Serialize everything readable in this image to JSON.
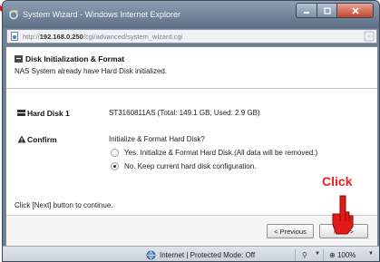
{
  "window": {
    "title": "System Wizard - Windows Internet Explorer"
  },
  "address": {
    "url_prefix": "http://",
    "url_host": "192.168.0.250",
    "url_path": "/cgi/advanced/system_wizard.cgi"
  },
  "wizard": {
    "title": "Disk Initialization & Format",
    "subtitle": "NAS System already have Hard Disk initialized.",
    "hard_disk_label": "Hard Disk 1",
    "hard_disk_value": "ST3160811AS (Total: 149.1 GB, Used: 2.9 GB)",
    "confirm_label": "Confirm",
    "confirm_question": "Initialize & Format Hard Disk?",
    "options": [
      {
        "label": "Yes. Initialize & Format Hard Disk.(All data will be removed.)",
        "selected": false
      },
      {
        "label": "No. Keep current hard disk configuration.",
        "selected": true
      }
    ],
    "footer_text": "Click [Next] button to continue.",
    "prev_button": "< Previous",
    "next_button": "Next >"
  },
  "overlay": {
    "click_text": "Click",
    "accent_color": "#ee1c1c"
  },
  "statusbar": {
    "zone_text": "Internet | Protected Mode: Off",
    "zoom": "100%"
  }
}
